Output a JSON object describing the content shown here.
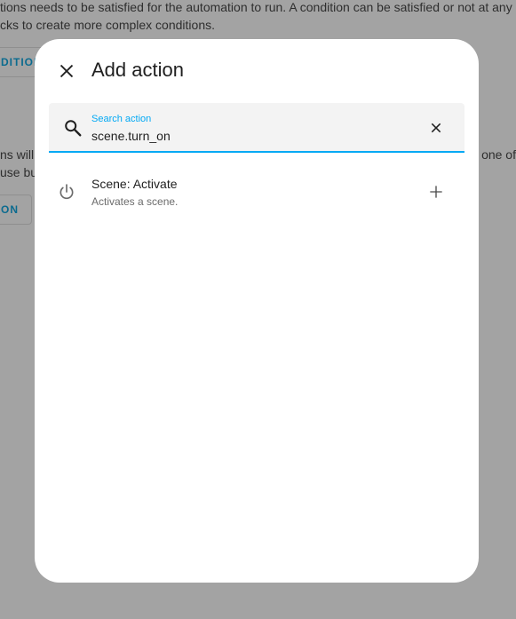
{
  "background": {
    "line1": "tions needs to be satisfied for the automation to run. A condition can be satisfied or not at any",
    "line2": "cks to create more complex conditions.",
    "button1": "DITION",
    "line3": "ns will",
    "line3_right": "one of",
    "line4": "use bui",
    "button2": "ON"
  },
  "dialog": {
    "title": "Add action",
    "close_icon": "close-icon"
  },
  "search": {
    "label": "Search action",
    "value": "scene.turn_on",
    "search_icon": "search-icon",
    "clear_icon": "close-icon"
  },
  "results": [
    {
      "icon": "power-icon",
      "title": "Scene: Activate",
      "description": "Activates a scene.",
      "add_icon": "plus-icon"
    }
  ],
  "colors": {
    "accent": "#03a9f4",
    "overlay": "#a3a3a3",
    "surface": "#ffffff"
  }
}
